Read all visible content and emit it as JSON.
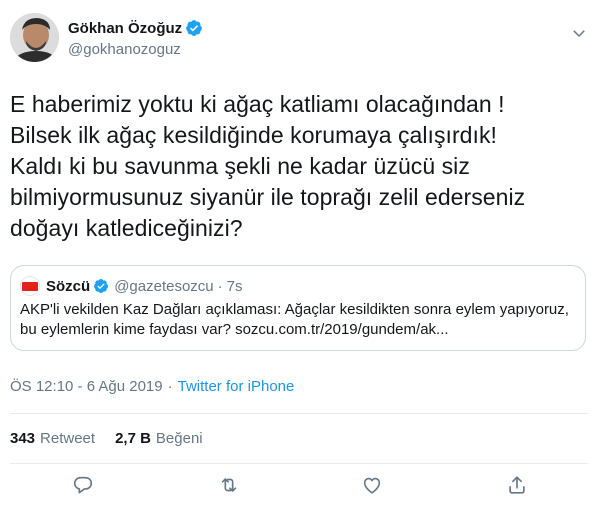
{
  "author": {
    "display_name": "Gökhan Özoğuz",
    "handle": "@gokhanozoguz"
  },
  "tweet": {
    "lines": [
      "E haberimiz yoktu ki ağaç katliamı olacağından !",
      "Bilsek ilk ağaç kesildiğinde korumaya çalışırdık!",
      "Kaldı ki bu savunma şekli ne kadar üzücü siz",
      "bilmiyormusunuz siyanür ile toprağı zelil ederseniz",
      "doğayı katlediceğinizi?"
    ]
  },
  "quoted": {
    "logo_text": "Sözcü",
    "display_name": "Sözcü",
    "handle": "@gazetesozcu",
    "separator": "·",
    "time": "7s",
    "lines": [
      "AKP'li vekilden Kaz Dağları açıklaması: Ağaçlar kesildikten sonra eylem yapıyoruz,",
      "bu eylemlerin kime faydası var? sozcu.com.tr/2019/gundem/ak..."
    ]
  },
  "meta": {
    "timestamp": "ÖS 12:10 - 6 Ağu 2019",
    "dot": "·",
    "source": "Twitter for iPhone"
  },
  "stats": {
    "retweets_count": "343",
    "retweets_label": "Retweet",
    "likes_count": "2,7 B",
    "likes_label": "Beğeni"
  },
  "colors": {
    "verified": "#1da1f2",
    "link": "#1b95e0",
    "secondary_text": "#657786",
    "icon": "#657786",
    "sozcu_red": "#e2231a"
  },
  "icons": {
    "verified": "verified-badge-icon",
    "chevron": "chevron-down-icon",
    "reply": "reply-icon",
    "retweet": "retweet-icon",
    "like": "heart-icon",
    "share": "share-icon"
  }
}
